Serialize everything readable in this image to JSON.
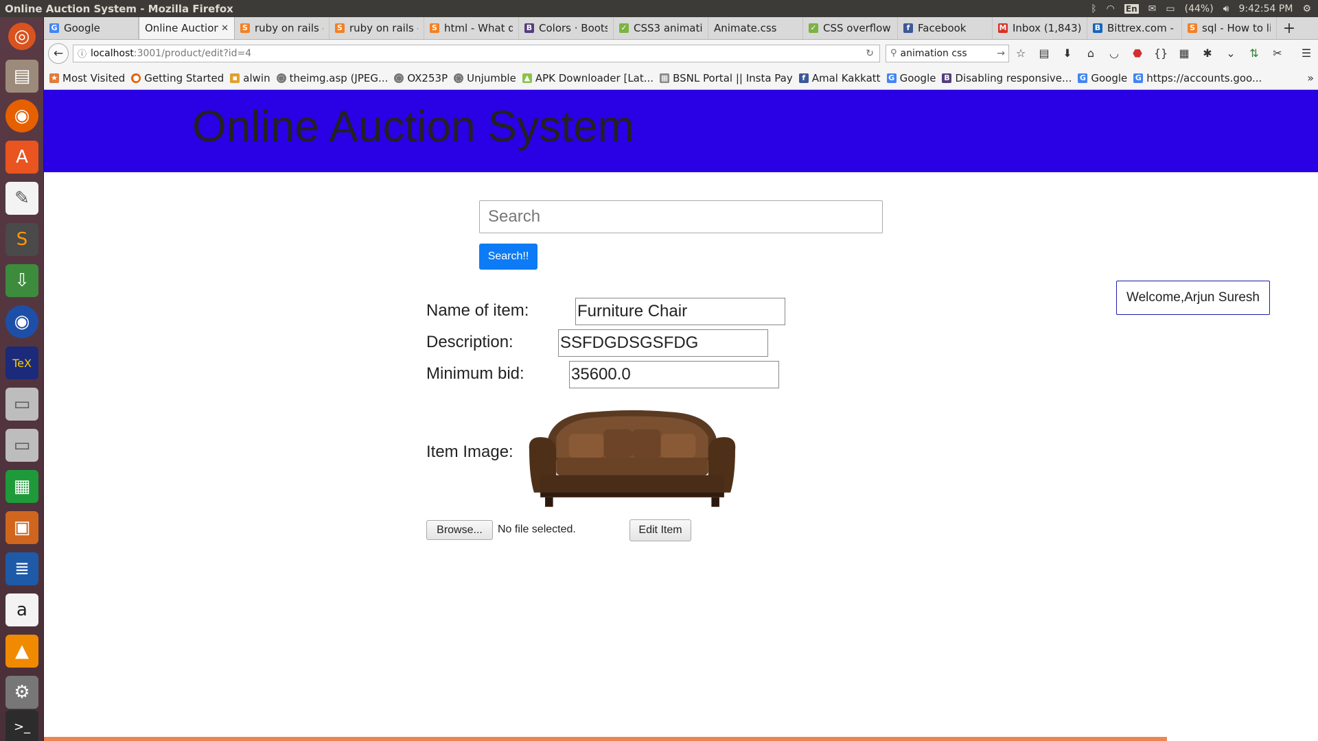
{
  "top_panel": {
    "window_title": "Online Auction System - Mozilla Firefox",
    "lang": "En",
    "battery": "(44%)",
    "clock": "9:42:54 PM"
  },
  "launcher": {
    "items": [
      "ubuntu-dash",
      "files",
      "firefox",
      "software-center",
      "text-editor",
      "sublime-text",
      "terminal-download",
      "firefox-dev",
      "texmaker",
      "drive",
      "drive-2",
      "calc",
      "impress",
      "writer",
      "amazon",
      "vlc",
      "system-settings",
      "terminal"
    ]
  },
  "tabs": [
    {
      "label": "Google",
      "icon": "G",
      "color": "#4285f4"
    },
    {
      "label": "Online Auction",
      "icon": "",
      "color": "",
      "active": true
    },
    {
      "label": "ruby on rails -",
      "icon": "S",
      "color": "#f48024"
    },
    {
      "label": "ruby on rails -",
      "icon": "S",
      "color": "#f48024"
    },
    {
      "label": "html - What d",
      "icon": "S",
      "color": "#f48024"
    },
    {
      "label": "Colors · Boots",
      "icon": "B",
      "color": "#563d7c"
    },
    {
      "label": "CSS3 animatio",
      "icon": "✓",
      "color": "#7cb342"
    },
    {
      "label": "Animate.css",
      "icon": "",
      "color": ""
    },
    {
      "label": "CSS overflow",
      "icon": "✓",
      "color": "#7cb342"
    },
    {
      "label": "Facebook",
      "icon": "f",
      "color": "#3b5998"
    },
    {
      "label": "Inbox (1,843)",
      "icon": "M",
      "color": "#d93025"
    },
    {
      "label": "Bittrex.com -",
      "icon": "B",
      "color": "#1565c0"
    },
    {
      "label": "sql - How to li",
      "icon": "S",
      "color": "#f48024"
    }
  ],
  "navbar": {
    "url_host": "localhost",
    "url_path": ":3001/product/edit?id=4",
    "search_value": "animation css"
  },
  "bookmarks": [
    {
      "label": "Most Visited",
      "icon": "★",
      "color": "#e07b39"
    },
    {
      "label": "Getting Started",
      "icon": "●",
      "color": "#e66000"
    },
    {
      "label": "alwin",
      "icon": "▪",
      "color": "#e0a030"
    },
    {
      "label": "theimg.asp (JPEG...",
      "icon": "◌",
      "color": "#777777"
    },
    {
      "label": "OX253P",
      "icon": "◌",
      "color": "#777777"
    },
    {
      "label": "Unjumble",
      "icon": "◌",
      "color": "#777777"
    },
    {
      "label": "APK Downloader [Lat...",
      "icon": "▲",
      "color": "#8bc34a"
    },
    {
      "label": "BSNL Portal || Insta Pay",
      "icon": "▦",
      "color": "#888888"
    },
    {
      "label": "Amal Kakkatt",
      "icon": "f",
      "color": "#3b5998"
    },
    {
      "label": "Google",
      "icon": "G",
      "color": "#4285f4"
    },
    {
      "label": "Disabling responsive...",
      "icon": "B",
      "color": "#563d7c"
    },
    {
      "label": "Google",
      "icon": "G",
      "color": "#4285f4"
    },
    {
      "label": "https://accounts.goo...",
      "icon": "G",
      "color": "#4285f4"
    }
  ],
  "page": {
    "site_title": "Online Auction System",
    "search_placeholder": "Search",
    "search_button": "Search!!",
    "welcome": "Welcome,Arjun Suresh",
    "form": {
      "name_label": "Name of item:",
      "name_value": "Furniture Chair",
      "description_label": "Description:",
      "description_value": "SSFDGDSGSFDG",
      "min_bid_label": "Minimum bid:",
      "min_bid_value": "35600.0",
      "image_label": "Item Image:",
      "browse_button": "Browse...",
      "file_status": "No file selected.",
      "submit_button": "Edit Item"
    }
  },
  "colors": {
    "banner": "#2a00e4",
    "search_button": "#0d7bf5",
    "welcome_border": "#1c1aa8"
  }
}
